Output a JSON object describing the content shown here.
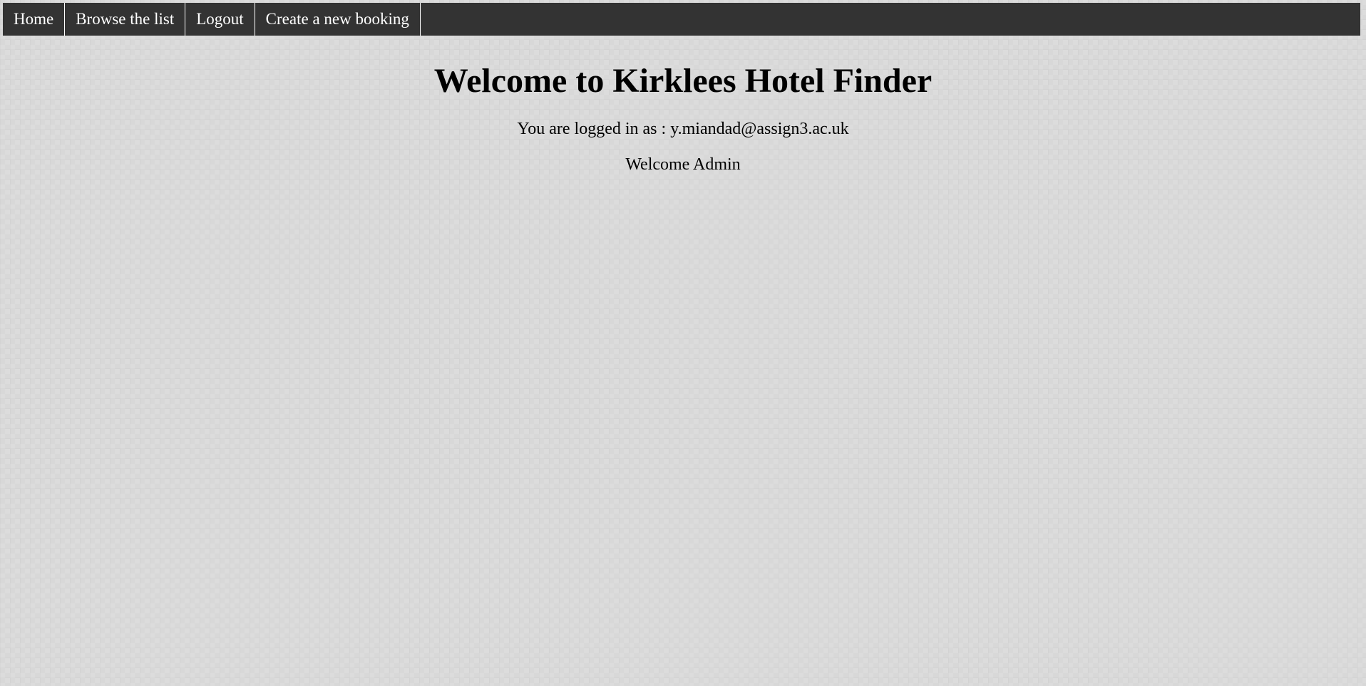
{
  "nav": {
    "items": [
      {
        "label": "Home"
      },
      {
        "label": "Browse the list"
      },
      {
        "label": "Logout"
      },
      {
        "label": "Create a new booking"
      }
    ]
  },
  "main": {
    "title": "Welcome to Kirklees Hotel Finder",
    "logged_in_text": "You are logged in as : y.miandad@assign3.ac.uk",
    "welcome_text": "Welcome Admin"
  },
  "colors": {
    "nav_background": "#333333",
    "nav_text": "#ffffff",
    "page_background": "#d8d8d8"
  }
}
